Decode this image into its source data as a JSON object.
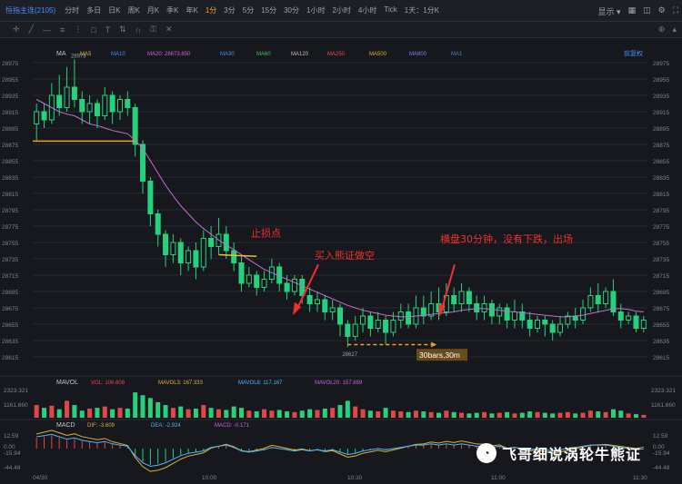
{
  "toolbar": {
    "symbol": "恒指主连(2105)",
    "timeframes": [
      "分时",
      "多日",
      "日K",
      "周K",
      "月K",
      "季K",
      "年K",
      "1分",
      "3分",
      "5分",
      "15分",
      "30分",
      "1小时",
      "2小时",
      "4小时",
      "Tick",
      "1天：1分K"
    ],
    "active": "1分",
    "display": "显示 ▾"
  },
  "drawbar": {
    "right_label": "前复权"
  },
  "indicators": {
    "main": "MA",
    "ma_labels": [
      "MA5",
      "MA10",
      "MA20: 28673.850",
      "MA30",
      "MA60",
      "MA120",
      "MA250",
      "MA500",
      "MA800",
      "MA1"
    ],
    "vol": "MAVOL",
    "vol_labels": [
      "VOL: 106.608",
      "MAVOL3: 167.333",
      "MAVOL8: 117.167",
      "MAVOL20: 157.859"
    ],
    "macd": "MACD",
    "macd_labels": [
      "DIF: -3.609",
      "DEA: -2.924",
      "MACD: -0.171"
    ]
  },
  "annotations": {
    "stop": "止损点",
    "buy": "买入熊证做空",
    "exit": "横盘30分钟，没有下跌，出场",
    "bars": "30bars,30m",
    "high_mark": "28979",
    "low_mark": "28627"
  },
  "watermark": "飞哥细说涡轮牛熊证",
  "vol_ticks": [
    "2323.321",
    "1161.660"
  ],
  "macd_ticks": [
    "12.59",
    "0.00",
    "-15.94",
    "-44.48"
  ],
  "x_ticks": [
    "04/30",
    "10:00",
    "10:30",
    "11:00",
    "11:30"
  ],
  "chart_data": {
    "type": "candlestick",
    "y_ticks": [
      28975,
      28955,
      28935,
      28915,
      28895,
      28875,
      28855,
      28835,
      28815,
      28795,
      28775,
      28755,
      28735,
      28715,
      28695,
      28675,
      28655,
      28635,
      28615
    ],
    "ylim": [
      28605,
      28985
    ],
    "stop_level": 28740,
    "entry_level": 28630,
    "bars": [
      [
        28900,
        28915,
        28880,
        28925
      ],
      [
        28915,
        28905,
        28895,
        28925
      ],
      [
        28905,
        28935,
        28900,
        28950
      ],
      [
        28935,
        28920,
        28910,
        28960
      ],
      [
        28920,
        28945,
        28915,
        28970
      ],
      [
        28945,
        28930,
        28920,
        28979
      ],
      [
        28930,
        28915,
        28900,
        28940
      ],
      [
        28915,
        28925,
        28900,
        28935
      ],
      [
        28925,
        28910,
        28895,
        28930
      ],
      [
        28910,
        28935,
        28905,
        28945
      ],
      [
        28935,
        28915,
        28900,
        28940
      ],
      [
        28915,
        28930,
        28905,
        28935
      ],
      [
        28930,
        28920,
        28910,
        28940
      ],
      [
        28920,
        28875,
        28860,
        28925
      ],
      [
        28875,
        28830,
        28815,
        28880
      ],
      [
        28830,
        28790,
        28775,
        28835
      ],
      [
        28790,
        28765,
        28750,
        28795
      ],
      [
        28765,
        28740,
        28725,
        28770
      ],
      [
        28740,
        28755,
        28730,
        28765
      ],
      [
        28755,
        28730,
        28715,
        28760
      ],
      [
        28730,
        28745,
        28720,
        28750
      ],
      [
        28745,
        28725,
        28710,
        28755
      ],
      [
        28725,
        28760,
        28720,
        28770
      ],
      [
        28760,
        28750,
        28735,
        28775
      ],
      [
        28750,
        28765,
        28740,
        28785
      ],
      [
        28765,
        28745,
        28735,
        28775
      ],
      [
        28745,
        28730,
        28720,
        28755
      ],
      [
        28730,
        28705,
        28695,
        28740
      ],
      [
        28705,
        28715,
        28700,
        28725
      ],
      [
        28715,
        28700,
        28690,
        28720
      ],
      [
        28700,
        28710,
        28695,
        28720
      ],
      [
        28710,
        28725,
        28705,
        28735
      ],
      [
        28725,
        28705,
        28695,
        28730
      ],
      [
        28705,
        28695,
        28685,
        28715
      ],
      [
        28695,
        28710,
        28690,
        28715
      ],
      [
        28710,
        28690,
        28680,
        28715
      ],
      [
        28690,
        28680,
        28670,
        28700
      ],
      [
        28680,
        28685,
        28670,
        28695
      ],
      [
        28685,
        28670,
        28660,
        28690
      ],
      [
        28670,
        28675,
        28660,
        28685
      ],
      [
        28675,
        28655,
        28640,
        28680
      ],
      [
        28655,
        28640,
        28627,
        28660
      ],
      [
        28640,
        28655,
        28635,
        28665
      ],
      [
        28655,
        28665,
        28645,
        28675
      ],
      [
        28665,
        28650,
        28640,
        28670
      ],
      [
        28650,
        28660,
        28645,
        28670
      ],
      [
        28660,
        28645,
        28630,
        28665
      ],
      [
        28645,
        28660,
        28640,
        28670
      ],
      [
        28660,
        28670,
        28650,
        28680
      ],
      [
        28670,
        28655,
        28650,
        28680
      ],
      [
        28655,
        28675,
        28650,
        28690
      ],
      [
        28675,
        28665,
        28655,
        28690
      ],
      [
        28665,
        28680,
        28660,
        28695
      ],
      [
        28680,
        28670,
        28660,
        28700
      ],
      [
        28670,
        28690,
        28665,
        28705
      ],
      [
        28690,
        28680,
        28670,
        28700
      ],
      [
        28680,
        28695,
        28670,
        28705
      ],
      [
        28695,
        28680,
        28670,
        28700
      ],
      [
        28680,
        28670,
        28660,
        28690
      ],
      [
        28670,
        28680,
        28660,
        28690
      ],
      [
        28680,
        28665,
        28655,
        28685
      ],
      [
        28665,
        28675,
        28655,
        28680
      ],
      [
        28675,
        28660,
        28650,
        28680
      ],
      [
        28660,
        28670,
        28650,
        28685
      ],
      [
        28670,
        28660,
        28650,
        28680
      ],
      [
        28660,
        28650,
        28640,
        28670
      ],
      [
        28650,
        28660,
        28645,
        28665
      ],
      [
        28660,
        28655,
        28640,
        28665
      ],
      [
        28655,
        28645,
        28635,
        28660
      ],
      [
        28645,
        28655,
        28640,
        28665
      ],
      [
        28655,
        28665,
        28650,
        28670
      ],
      [
        28665,
        28660,
        28650,
        28675
      ],
      [
        28660,
        28675,
        28655,
        28685
      ],
      [
        28675,
        28690,
        28670,
        28700
      ],
      [
        28690,
        28680,
        28670,
        28705
      ],
      [
        28680,
        28695,
        28675,
        28700
      ],
      [
        28695,
        28670,
        28665,
        28710
      ],
      [
        28670,
        28660,
        28650,
        28680
      ],
      [
        28660,
        28665,
        28655,
        28670
      ],
      [
        28665,
        28650,
        28645,
        28670
      ],
      [
        28650,
        28660,
        28645,
        28665
      ]
    ],
    "ma20": [
      28930,
      28925,
      28920,
      28915,
      28912,
      28910,
      28905,
      28900,
      28898,
      28895,
      28892,
      28890,
      28888,
      28880,
      28870,
      28855,
      28840,
      28825,
      28812,
      28800,
      28790,
      28780,
      28772,
      28765,
      28758,
      28752,
      28746,
      28740,
      28734,
      28728,
      28722,
      28718,
      28714,
      28710,
      28706,
      28702,
      28698,
      28694,
      28690,
      28686,
      28682,
      28678,
      28675,
      28672,
      28670,
      28668,
      28666,
      28665,
      28664,
      28664,
      28665,
      28666,
      28667,
      28668,
      28669,
      28670,
      28672,
      28673,
      28674,
      28674,
      28673,
      28672,
      28671,
      28670,
      28669,
      28668,
      28667,
      28666,
      28665,
      28664,
      28664,
      28665,
      28666,
      28668,
      28670,
      28672,
      28674,
      28674,
      28673,
      28671,
      28670
    ],
    "volume": [
      900,
      700,
      850,
      600,
      1200,
      900,
      500,
      650,
      700,
      800,
      600,
      700,
      650,
      1800,
      1600,
      1400,
      1100,
      900,
      700,
      800,
      600,
      650,
      900,
      700,
      600,
      550,
      800,
      700,
      500,
      450,
      600,
      500,
      550,
      450,
      400,
      500,
      600,
      550,
      650,
      700,
      900,
      1200,
      800,
      600,
      500,
      450,
      700,
      500,
      450,
      400,
      500,
      450,
      400,
      350,
      500,
      400,
      350,
      300,
      350,
      400,
      300,
      350,
      400,
      300,
      350,
      450,
      400,
      350,
      300,
      350,
      400,
      300,
      350,
      500,
      450,
      400,
      600,
      500,
      300,
      250,
      200
    ],
    "macd": [
      10,
      11,
      12,
      10,
      8,
      9,
      7,
      6,
      5,
      6,
      4,
      3,
      2,
      -6,
      -12,
      -15,
      -14,
      -12,
      -9,
      -6,
      -4,
      -3,
      -2,
      1,
      2,
      3,
      1,
      -2,
      -3,
      -2,
      -1,
      1,
      0,
      -1,
      -2,
      -1,
      -2,
      -1,
      -2,
      -1,
      -3,
      -5,
      -4,
      -2,
      -1,
      0,
      -1,
      0,
      1,
      2,
      3,
      3,
      4,
      3,
      4,
      3,
      4,
      3,
      2,
      2,
      1,
      2,
      0,
      1,
      0,
      -1,
      0,
      -1,
      -2,
      -1,
      0,
      1,
      2,
      3,
      3,
      3,
      2,
      1,
      0,
      -1,
      -0.17
    ]
  }
}
